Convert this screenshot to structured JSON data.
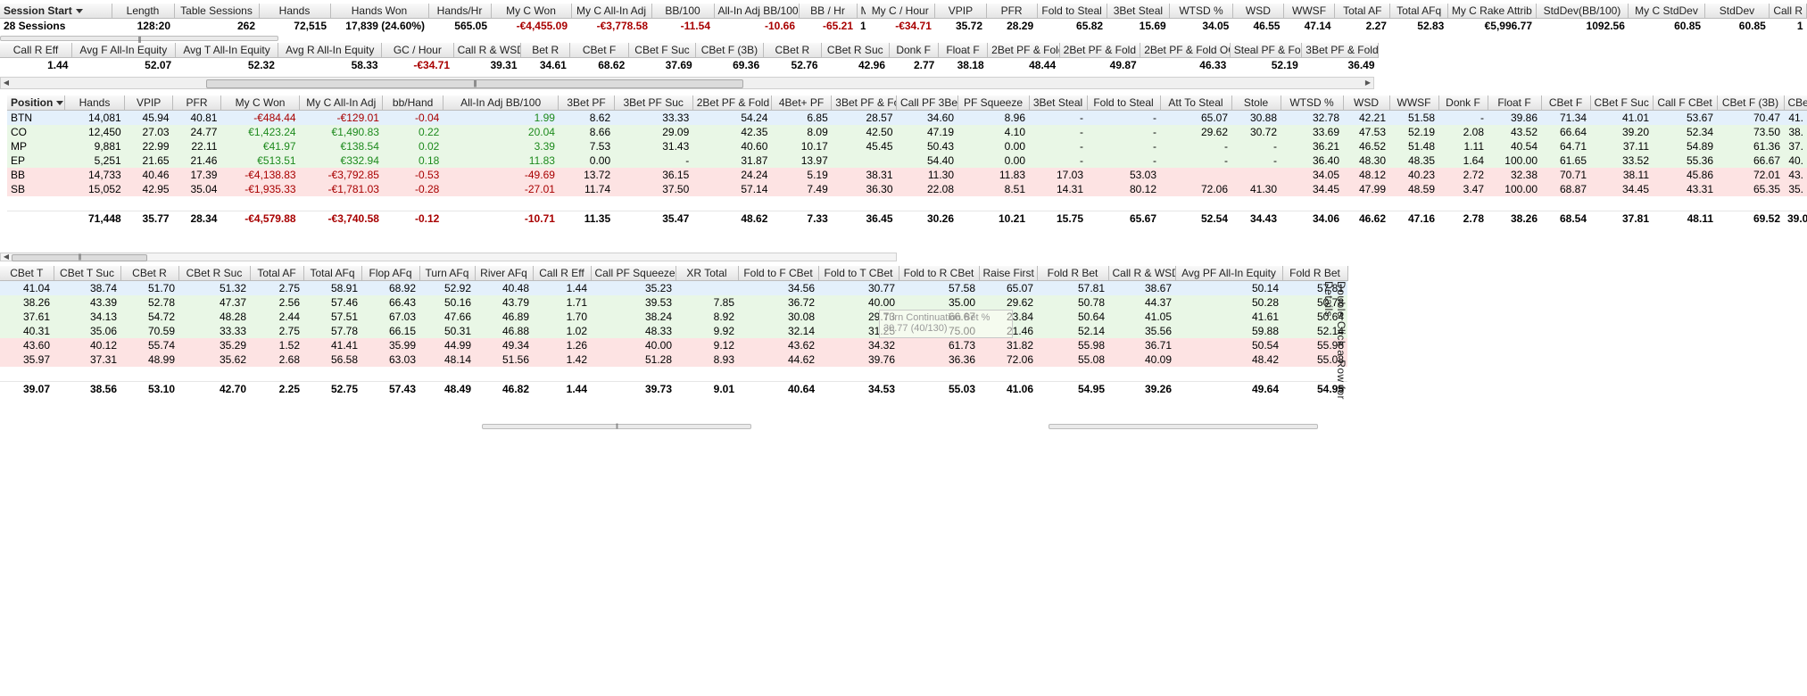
{
  "summary": {
    "columns": [
      "Session Start",
      "Length",
      "Table Sessions",
      "Hands",
      "Hands Won",
      "Hands/Hr",
      "My C Won",
      "My C All-In Adj",
      "BB/100",
      "All-In Adj BB/100",
      "BB / Hr",
      "M"
    ],
    "row": [
      "28 Sessions",
      "128:20",
      "262",
      "72,515",
      "17,839 (24.60%)",
      "565.05",
      "-€4,455.09",
      "-€3,778.58",
      "-11.54",
      "-10.66",
      "-65.21",
      "1"
    ]
  },
  "summary_right": {
    "columns": [
      "My C / Hour",
      "VPIP",
      "PFR",
      "Fold to Steal",
      "3Bet Steal",
      "WTSD %",
      "WSD",
      "WWSF",
      "Total AF",
      "Total AFq",
      "My C Rake Attrib",
      "StdDev(BB/100)",
      "My C StdDev",
      "StdDev",
      "Call R"
    ],
    "row": [
      "-€34.71",
      "35.72",
      "28.29",
      "65.82",
      "15.69",
      "34.05",
      "46.55",
      "47.14",
      "2.27",
      "52.83",
      "€5,996.77",
      "1092.56",
      "60.85",
      "60.85",
      "1"
    ]
  },
  "summary2": {
    "columns": [
      "Call R Eff",
      "Avg F All-In Equity",
      "Avg T All-In Equity",
      "Avg R All-In Equity",
      "GC / Hour",
      "Call R & WSD",
      "Bet R",
      "CBet F",
      "CBet F Suc",
      "CBet F (3B)",
      "CBet R",
      "CBet R Suc",
      "Donk F",
      "Float F",
      "2Bet PF & Fold",
      "2Bet PF & Fold IP",
      "2Bet PF & Fold OOP",
      "Steal PF & Fold",
      "3Bet PF & Fold"
    ],
    "row": [
      "1.44",
      "52.07",
      "52.32",
      "58.33",
      "-€34.71",
      "39.31",
      "34.61",
      "68.62",
      "37.69",
      "69.36",
      "52.76",
      "42.96",
      "2.77",
      "38.18",
      "48.44",
      "49.87",
      "46.33",
      "52.19",
      "36.49"
    ],
    "left_stub": "5"
  },
  "pos_left": {
    "columns": [
      "Position",
      "Hands",
      "VPIP",
      "PFR",
      "My C Won",
      "My C All-In Adj",
      "bb/Hand",
      "All-In Adj BB/100",
      "3Bet PF",
      "3Bet PF Suc",
      "2Bet PF & Fold",
      "4Bet+ PF",
      "3Bet PF & Fold"
    ],
    "rows": [
      [
        "BTN",
        "14,081",
        "45.94",
        "40.81",
        "-€484.44",
        "-€129.01",
        "-0.04",
        "1.99",
        "8.62",
        "33.33",
        "54.24",
        "6.85",
        "28.57"
      ],
      [
        "CO",
        "12,450",
        "27.03",
        "24.77",
        "€1,423.24",
        "€1,490.83",
        "0.22",
        "20.04",
        "8.66",
        "29.09",
        "42.35",
        "8.09",
        "42.50"
      ],
      [
        "MP",
        "9,881",
        "22.99",
        "22.11",
        "€41.97",
        "€138.54",
        "0.02",
        "3.39",
        "7.53",
        "31.43",
        "40.60",
        "10.17",
        "45.45"
      ],
      [
        "EP",
        "5,251",
        "21.65",
        "21.46",
        "€513.51",
        "€332.94",
        "0.18",
        "11.83",
        "0.00",
        "-",
        "31.87",
        "13.97",
        ""
      ],
      [
        "BB",
        "14,733",
        "40.46",
        "17.39",
        "-€4,138.83",
        "-€3,792.85",
        "-0.53",
        "-49.69",
        "13.72",
        "36.15",
        "24.24",
        "5.19",
        "38.31"
      ],
      [
        "SB",
        "15,052",
        "42.95",
        "35.04",
        "-€1,935.33",
        "-€1,781.03",
        "-0.28",
        "-27.01",
        "11.74",
        "37.50",
        "57.14",
        "7.49",
        "36.30"
      ]
    ],
    "total": [
      "",
      "71,448",
      "35.77",
      "28.34",
      "-€4,579.88",
      "-€3,740.58",
      "-0.12",
      "-10.71",
      "11.35",
      "35.47",
      "48.62",
      "7.33",
      "36.45"
    ]
  },
  "pos_right": {
    "columns": [
      "Call PF 3Bet",
      "PF Squeeze",
      "3Bet Steal",
      "Fold to Steal",
      "Att To Steal",
      "Stole",
      "WTSD %",
      "WSD",
      "WWSF",
      "Donk F",
      "Float F",
      "CBet F",
      "CBet F Suc",
      "Call F CBet",
      "CBet F (3B)",
      "CBet T"
    ],
    "rows": [
      [
        "34.60",
        "8.96",
        "-",
        "-",
        "65.07",
        "30.88",
        "32.78",
        "42.21",
        "51.58",
        "-",
        "39.86",
        "71.34",
        "41.01",
        "53.67",
        "70.47",
        "41."
      ],
      [
        "47.19",
        "4.10",
        "-",
        "-",
        "29.62",
        "30.72",
        "33.69",
        "47.53",
        "52.19",
        "2.08",
        "43.52",
        "66.64",
        "39.20",
        "52.34",
        "73.50",
        "38."
      ],
      [
        "50.43",
        "0.00",
        "-",
        "-",
        "-",
        "-",
        "36.21",
        "46.52",
        "51.48",
        "1.11",
        "40.54",
        "64.71",
        "37.11",
        "54.89",
        "61.36",
        "37."
      ],
      [
        "54.40",
        "0.00",
        "-",
        "-",
        "-",
        "-",
        "36.40",
        "48.30",
        "48.35",
        "1.64",
        "100.00",
        "61.65",
        "33.52",
        "55.36",
        "66.67",
        "40."
      ],
      [
        "11.30",
        "11.83",
        "17.03",
        "53.03",
        "",
        "",
        "34.05",
        "48.12",
        "40.23",
        "2.72",
        "32.38",
        "70.71",
        "38.11",
        "45.86",
        "72.01",
        "43."
      ],
      [
        "22.08",
        "8.51",
        "14.31",
        "80.12",
        "72.06",
        "41.30",
        "34.45",
        "47.99",
        "48.59",
        "3.47",
        "100.00",
        "68.87",
        "34.45",
        "43.31",
        "65.35",
        "35."
      ]
    ],
    "total": [
      "30.26",
      "10.21",
      "15.75",
      "65.67",
      "52.54",
      "34.43",
      "34.06",
      "46.62",
      "47.16",
      "2.78",
      "38.26",
      "68.54",
      "37.81",
      "48.11",
      "69.52",
      "39.0"
    ]
  },
  "pos_lower": {
    "columns": [
      "CBet T",
      "CBet T Suc",
      "CBet R",
      "CBet R Suc",
      "Total AF",
      "Total AFq",
      "Flop AFq",
      "Turn AFq",
      "River AFq",
      "Call R Eff",
      "Call PF Squeeze",
      "XR Total",
      "Fold to F CBet",
      "Fold to T CBet",
      "Fold to R CBet",
      "Raise First",
      "Fold R Bet",
      "Call R & WSD",
      "Avg PF All-In Equity",
      "Fold R Bet"
    ],
    "rows": [
      [
        "41.04",
        "38.74",
        "51.70",
        "51.32",
        "2.75",
        "58.91",
        "68.92",
        "52.92",
        "40.48",
        "1.44",
        "35.23",
        "",
        "34.56",
        "30.77",
        "57.58",
        "65.07",
        "57.81",
        "38.67",
        "50.14",
        "57.81"
      ],
      [
        "38.26",
        "43.39",
        "52.78",
        "47.37",
        "2.56",
        "57.46",
        "66.43",
        "50.16",
        "43.79",
        "1.71",
        "39.53",
        "7.85",
        "36.72",
        "40.00",
        "35.00",
        "29.62",
        "50.78",
        "44.37",
        "50.28",
        "50.78"
      ],
      [
        "37.61",
        "34.13",
        "54.72",
        "48.28",
        "2.44",
        "57.51",
        "67.03",
        "47.66",
        "46.89",
        "1.70",
        "38.24",
        "8.92",
        "30.08",
        "29.73",
        "66.67",
        "23.84",
        "50.64",
        "41.05",
        "41.61",
        "50.64"
      ],
      [
        "40.31",
        "35.06",
        "70.59",
        "33.33",
        "2.75",
        "57.78",
        "66.15",
        "50.31",
        "46.88",
        "1.02",
        "48.33",
        "9.92",
        "32.14",
        "31.25",
        "75.00",
        "21.46",
        "52.14",
        "35.56",
        "59.88",
        "52.14"
      ],
      [
        "43.60",
        "40.12",
        "55.74",
        "35.29",
        "1.52",
        "41.41",
        "35.99",
        "44.99",
        "49.34",
        "1.26",
        "40.00",
        "9.12",
        "43.62",
        "34.32",
        "61.73",
        "31.82",
        "55.98",
        "36.71",
        "50.54",
        "55.98"
      ],
      [
        "35.97",
        "37.31",
        "48.99",
        "35.62",
        "2.68",
        "56.58",
        "63.03",
        "48.14",
        "51.56",
        "1.42",
        "51.28",
        "8.93",
        "44.62",
        "39.76",
        "36.36",
        "72.06",
        "55.08",
        "40.09",
        "48.42",
        "55.08"
      ]
    ],
    "total": [
      "39.07",
      "38.56",
      "53.10",
      "42.70",
      "2.25",
      "52.75",
      "57.43",
      "48.49",
      "46.82",
      "1.44",
      "39.73",
      "9.01",
      "40.64",
      "34.53",
      "55.03",
      "41.06",
      "54.95",
      "39.26",
      "49.64",
      "54.95"
    ]
  },
  "tooltip": {
    "title": "Turn Continuation Bet %",
    "detail": "30.77 (40/130)"
  },
  "side_hint": "Double Click a Row for Details",
  "colors": {
    "header_bg": "#e8e8e8",
    "blue_row": "#e4f0fb",
    "green_row": "#e9f7e6",
    "red_row": "#fde3e3",
    "negative": "#a80000",
    "positive": "#1d8a1d"
  }
}
